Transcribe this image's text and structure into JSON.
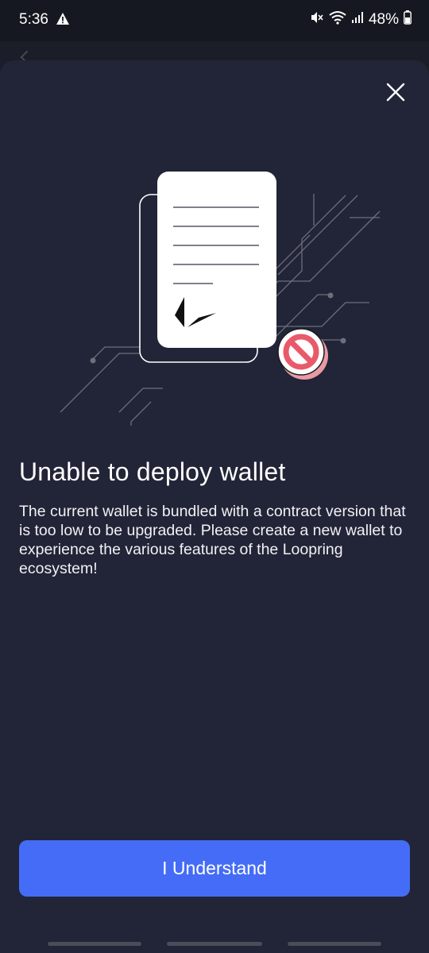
{
  "status_bar": {
    "time": "5:36",
    "battery": "48%",
    "icons": [
      "warning-icon",
      "mute-icon",
      "wifi-icon",
      "signal-icon",
      "battery-icon"
    ]
  },
  "dialog": {
    "close_icon": "close-icon",
    "illustration": "document-with-loopring-logo-and-prohibited-icon",
    "title": "Unable to deploy wallet",
    "description": "The current wallet is bundled with a contract version that is too low to be upgraded. Please create a new wallet to experience the various features of the Loopring ecosystem!",
    "button_label": "I Understand"
  },
  "colors": {
    "background": "#161821",
    "sheet": "#222437",
    "accent": "#446cf6",
    "prohibited": "#e85a6a"
  }
}
